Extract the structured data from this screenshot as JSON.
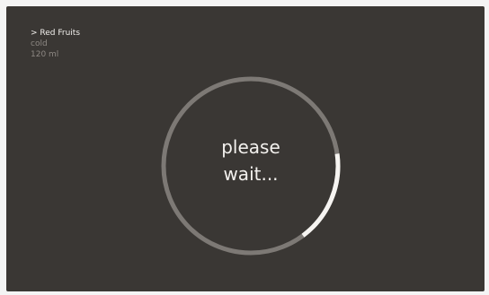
{
  "info": {
    "selection": "> Red Fruits",
    "temperature": "cold",
    "volume": "120 ml"
  },
  "spinner": {
    "line1": "please",
    "line2": "wait...",
    "progress": 0.17,
    "track_color": "#7d7975",
    "arc_color": "#f6f4f1"
  },
  "colors": {
    "background": "#3a3734"
  }
}
